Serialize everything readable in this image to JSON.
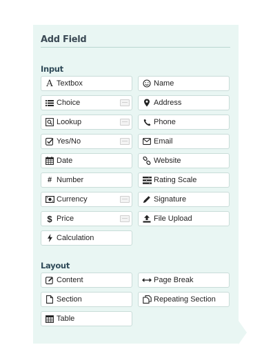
{
  "panel": {
    "title": "Add Field"
  },
  "sections": {
    "input": {
      "label": "Input",
      "fields": [
        {
          "label": "Textbox",
          "icon": "textbox-icon"
        },
        {
          "label": "Name",
          "icon": "smiley-icon"
        },
        {
          "label": "Choice",
          "icon": "list-icon",
          "has_options": true
        },
        {
          "label": "Address",
          "icon": "map-pin-icon"
        },
        {
          "label": "Lookup",
          "icon": "lookup-icon",
          "has_options": true
        },
        {
          "label": "Phone",
          "icon": "phone-icon"
        },
        {
          "label": "Yes/No",
          "icon": "checkbox-icon",
          "has_options": true
        },
        {
          "label": "Email",
          "icon": "envelope-icon"
        },
        {
          "label": "Date",
          "icon": "calendar-icon"
        },
        {
          "label": "Website",
          "icon": "link-icon"
        },
        {
          "label": "Number",
          "icon": "hash-icon"
        },
        {
          "label": "Rating Scale",
          "icon": "rating-scale-icon"
        },
        {
          "label": "Currency",
          "icon": "money-icon",
          "has_options": true
        },
        {
          "label": "Signature",
          "icon": "pen-icon"
        },
        {
          "label": "Price",
          "icon": "dollar-icon",
          "has_options": true
        },
        {
          "label": "File Upload",
          "icon": "upload-icon"
        },
        {
          "label": "Calculation",
          "icon": "bolt-icon"
        }
      ]
    },
    "layout": {
      "label": "Layout",
      "fields": [
        {
          "label": "Content",
          "icon": "edit-icon"
        },
        {
          "label": "Page Break",
          "icon": "arrows-horizontal-icon"
        },
        {
          "label": "Section",
          "icon": "document-icon"
        },
        {
          "label": "Repeating Section",
          "icon": "repeating-section-icon"
        },
        {
          "label": "Table",
          "icon": "table-icon"
        }
      ]
    }
  }
}
